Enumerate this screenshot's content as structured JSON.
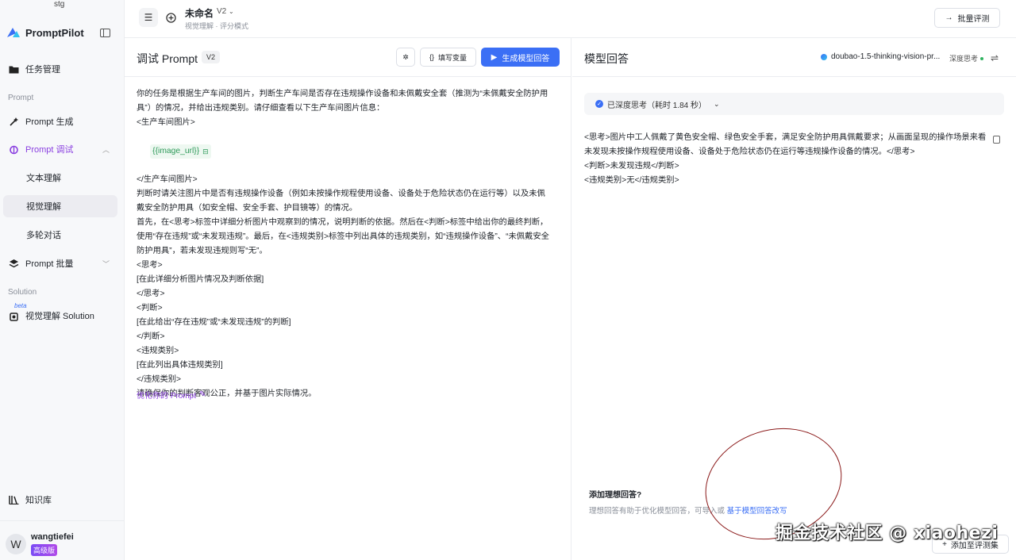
{
  "sidebar": {
    "env": "stg",
    "brand": "PromptPilot",
    "items": {
      "task_mgmt": "任务管理",
      "section_prompt": "Prompt",
      "prompt_gen": "Prompt 生成",
      "prompt_debug": "Prompt 调试",
      "text_understanding": "文本理解",
      "visual_understanding": "视觉理解",
      "multi_turn": "多轮对话",
      "prompt_batch": "Prompt 批量",
      "section_solution": "Solution",
      "beta": "beta",
      "visual_solution": "视觉理解 Solution",
      "knowledge_base": "知识库"
    },
    "user": {
      "avatar": "W",
      "name": "wangtiefei",
      "badge": "高级版"
    }
  },
  "topbar": {
    "title": "未命名",
    "version": "V2",
    "subtitle": "视觉理解 · 评分模式",
    "batch_eval": "批量评测"
  },
  "editor": {
    "title": "调试 Prompt",
    "version": "V2",
    "fill_vars": "填写变量",
    "generate": "生成模型回答",
    "lines": [
      "你的任务是根据生产车间的图片，判断生产车间是否存在违规操作设备和未佩戴安全套（推测为“未佩戴安全防护用",
      "具”）的情况，并给出违规类别。请仔细查看以下生产车间图片信息：",
      "<生产车间图片>",
      "</生产车间图片>",
      "判断时请关注图片中是否有违规操作设备（例如未按操作规程使用设备、设备处于危险状态仍在运行等）以及未佩",
      "戴安全防护用具（如安全帽、安全手套、护目镜等）的情况。",
      "首先，在<思考>标签中详细分析图片中观察到的情况，说明判断的依据。然后在<判断>标签中给出你的最终判断，",
      "使用“存在违规”或“未发现违规”。最后，在<违规类别>标签中列出具体的违规类别，如“违规操作设备”、“未佩戴安全",
      "防护用具”，若未发现违规则写“无”。",
      "<思考>",
      "[在此详细分析图片情况及判断依据]",
      "</思考>",
      "<判断>",
      "[在此给出“存在违规”或“未发现违规”的判断]",
      "</判断>",
      "<违规类别>",
      "[在此列出具体违规类别]",
      "</违规类别>",
      "请确保你的判断客观公正，并基于图片实际情况。"
    ],
    "variable": "{{image_url}}",
    "optimize": "优化你的 Prompt"
  },
  "response": {
    "title": "模型回答",
    "model": "doubao-1.5-thinking-vision-pr...",
    "deep_think": "深度思考",
    "think_status": "已深度思考（耗时 1.84 秒）",
    "lines": [
      "<思考>图片中工人佩戴了黄色安全帽、绿色安全手套，满足安全防护用具佩戴要求；从画面呈现的操作场景来看",
      "未发现未按操作规程使用设备、设备处于危险状态仍在运行等违规操作设备的情况。</思考>",
      "<判断>未发现违规</判断>",
      "<违规类别>无</违规类别>"
    ],
    "ideal_title": "添加理想回答?",
    "ideal_desc": "理想回答有助于优化模型回答，可导入或 ",
    "ideal_link": "基于模型回答改写",
    "add_eval": "添加至评测集"
  },
  "watermark": "掘金技术社区 @ xiaohezi",
  "colors": {
    "accent": "#3b6ff5",
    "purple": "#8a3fe0",
    "var_green": "#2f9a5a"
  }
}
